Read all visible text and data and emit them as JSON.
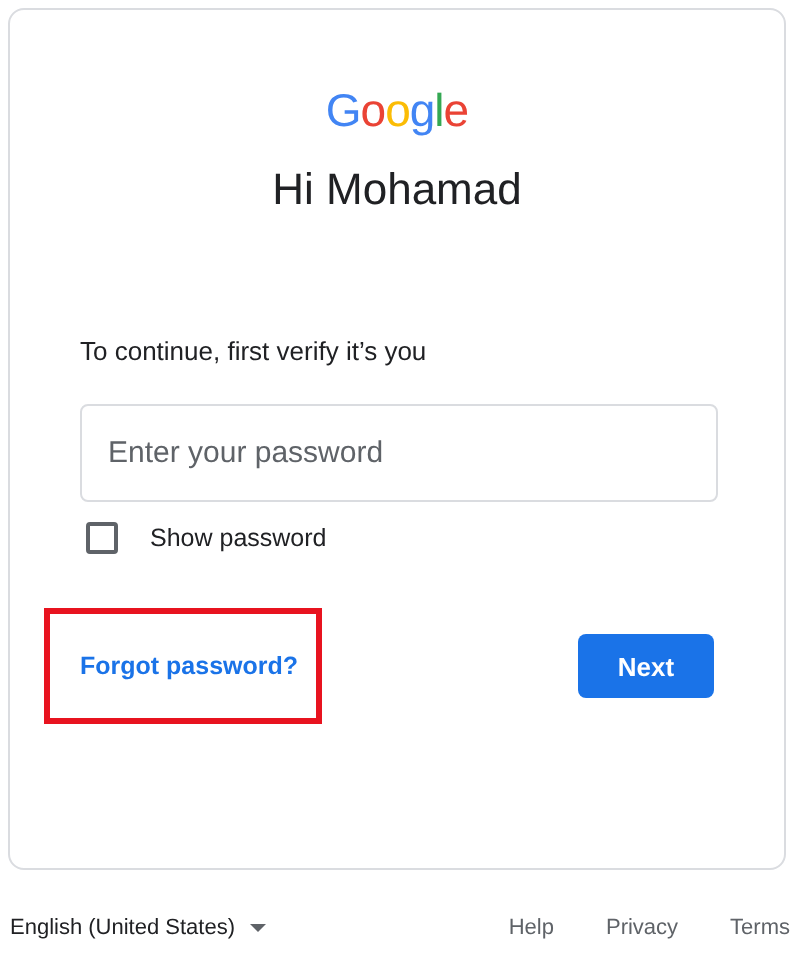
{
  "logo": [
    {
      "char": "G",
      "color": "#4285f4"
    },
    {
      "char": "o",
      "color": "#ea4335"
    },
    {
      "char": "o",
      "color": "#fbbc05"
    },
    {
      "char": "g",
      "color": "#4285f4"
    },
    {
      "char": "l",
      "color": "#34a853"
    },
    {
      "char": "e",
      "color": "#ea4335"
    }
  ],
  "greeting": "Hi Mohamad",
  "prompt": "To continue, first verify it’s you",
  "password_field": {
    "placeholder": "Enter your password"
  },
  "show_password": {
    "label": "Show password",
    "checked": false
  },
  "forgot_link": {
    "text": "Forgot password?",
    "highlighted": true
  },
  "next_button": "Next",
  "footer": {
    "language": "English (United States)",
    "links": [
      "Help",
      "Privacy",
      "Terms"
    ]
  }
}
